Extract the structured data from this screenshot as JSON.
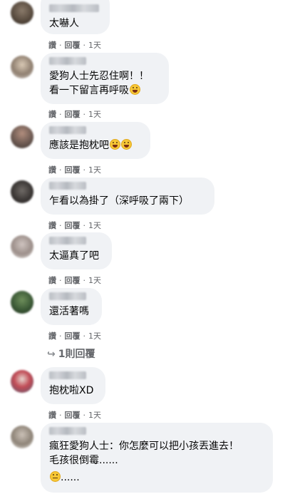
{
  "actions": {
    "like": "讚",
    "dot": "·",
    "reply": "回覆"
  },
  "comments": [
    {
      "text": [
        "太嚇人"
      ],
      "time": "1天"
    },
    {
      "text": [
        "愛狗人士先忍住啊！！",
        "看一下留言再呼吸"
      ],
      "time": "1天",
      "emoji": [
        "laugh-cry-emoji"
      ]
    },
    {
      "text": [
        "應該是抱枕吧"
      ],
      "time": "1天",
      "emoji": [
        "laugh-cry-emoji",
        "laugh-cry-emoji"
      ]
    },
    {
      "text": [
        "乍看以為掛了（深呼吸了兩下）"
      ],
      "time": "1天"
    },
    {
      "text": [
        "太逼真了吧"
      ],
      "time": "1天"
    },
    {
      "text": [
        "還活著嗎"
      ],
      "time": "1天",
      "replies_label": "1則回覆"
    },
    {
      "text": [
        "抱枕啦XD"
      ],
      "time": "1天"
    },
    {
      "text": [
        "瘋狂愛狗人士：你怎麼可以把小孩丟進去！",
        "毛孩很倒霉......",
        "......"
      ],
      "emoji": [
        "eye-roll-emoji"
      ]
    }
  ],
  "colors": {
    "bubble": "#f0f2f5",
    "meta_text": "#65676b",
    "body_text": "#050505"
  }
}
